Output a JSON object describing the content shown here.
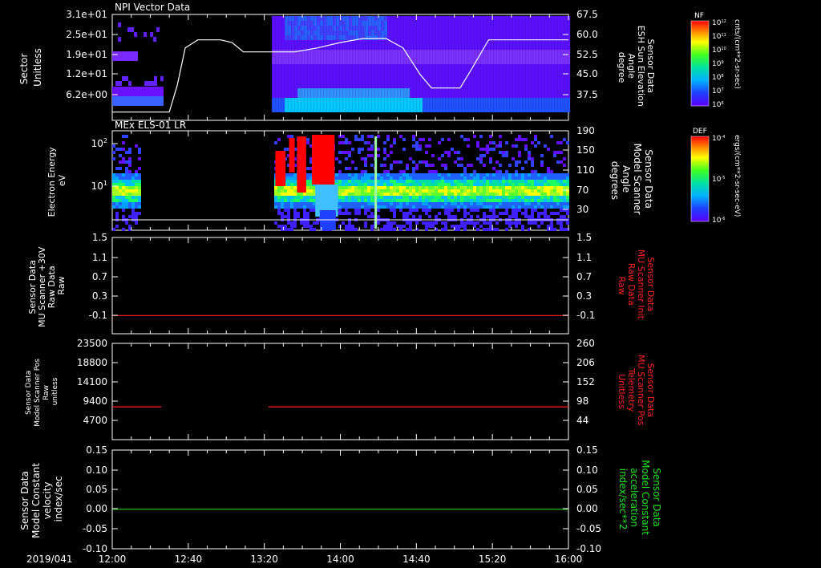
{
  "chart_data": [
    {
      "type": "heatmap",
      "title": "NPI Vector Data",
      "ylabel_left": [
        "Sector",
        "Unitless"
      ],
      "yticks_left": [
        "3.1e+01",
        "2.5e+01",
        "1.9e+01",
        "1.2e+01",
        "6.2e+00"
      ],
      "ylabel_right": [
        "Sensor Data",
        "ESH Sun Elevation",
        "Angle",
        "degree"
      ],
      "yticks_right": [
        "67.5",
        "60.0",
        "52.5",
        "45.0",
        "37.5"
      ],
      "colorbar": {
        "label": "NF",
        "units": "cnts/(cm**2-sr-sec)",
        "ticks": [
          "10^12",
          "10^11",
          "10^10",
          "10^9",
          "10^8",
          "10^7",
          "10^6"
        ]
      },
      "overlay_line": {
        "name": "ESH Sun Elevation Angle",
        "color": "#ffffff",
        "x_hours": [
          12.0,
          12.5,
          12.57,
          12.64,
          12.75,
          12.95,
          13.05,
          13.15,
          13.35,
          13.6,
          13.8,
          14.0,
          14.2,
          14.4,
          14.55,
          14.7,
          14.8,
          14.95,
          15.05,
          15.15,
          15.3,
          15.5,
          15.7,
          16.0
        ],
        "y": [
          31,
          31,
          41,
          55,
          58,
          58,
          57,
          53.5,
          53.5,
          53.5,
          55,
          57,
          58.5,
          58.5,
          55,
          45,
          40,
          40,
          40,
          47,
          58,
          58,
          58,
          58
        ]
      },
      "color": "#ffffff"
    },
    {
      "type": "heatmap",
      "title": "MEx ELS-01 LR",
      "ylabel_left": [
        "Electron Energy",
        "eV"
      ],
      "yticks_left": [
        "10^2",
        "10^1"
      ],
      "ylabel_right": [
        "Sensor Data",
        "Model Scanner",
        "Angle",
        "degrees"
      ],
      "yticks_right": [
        "190",
        "150",
        "110",
        "70",
        "30"
      ],
      "colorbar": {
        "label": "DEF",
        "units": "ergs/(cm**2-sr-sec-eV)",
        "ticks": [
          "10^-4",
          "10^-5",
          "10^-6"
        ]
      },
      "overlay_line": {
        "name": "Model Scanner Angle",
        "color": "#ffffff",
        "x_hours": [
          12.0,
          16.0
        ],
        "y": [
          10,
          10
        ]
      }
    },
    {
      "type": "line",
      "ylabel_left": [
        "Sensor Data",
        "MU Scanner +30V",
        "Raw Data",
        "Raw"
      ],
      "yticks_left": [
        "1.5",
        "1.1",
        "0.7",
        "0.3",
        "-0.1"
      ],
      "ylabel_right": [
        "Sensor Data",
        "MU Scanner Init",
        "Raw Data",
        "Raw"
      ],
      "yticks_right": [
        "1.5",
        "1.1",
        "0.7",
        "0.3",
        "-0.1"
      ],
      "ylim": [
        -0.35,
        1.5
      ],
      "series": [
        {
          "color": "#ff2020",
          "x_hours": [
            12.0,
            16.0
          ],
          "y": [
            0.0,
            0.0
          ]
        }
      ],
      "right_label_color": "#ff2020"
    },
    {
      "type": "line",
      "ylabel_left": [
        "Sensor Data",
        "Model Scanner Pos",
        "Raw",
        "unitless"
      ],
      "yticks_left": [
        "23500",
        "18800",
        "14100",
        "9400",
        "4700"
      ],
      "ylabel_right": [
        "Sensor Data",
        "MU Scanner Pos",
        "Telemetry",
        "Unitless"
      ],
      "yticks_right": [
        "260",
        "206",
        "152",
        "98",
        "44"
      ],
      "ylim": [
        0,
        23500
      ],
      "series": [
        {
          "color": "#ff2020",
          "x_hours": [
            12.0,
            12.43
          ],
          "y": [
            8000,
            8000
          ]
        },
        {
          "color": "#ff2020",
          "x_hours": [
            13.37,
            16.0
          ],
          "y": [
            8000,
            8000
          ]
        }
      ],
      "right_label_color": "#ff2020"
    },
    {
      "type": "line",
      "ylabel_left": [
        "Sensor Data",
        "Model Constant",
        "velocity",
        "index/sec"
      ],
      "yticks_left": [
        "0.15",
        "0.10",
        "0.05",
        "0.00",
        "-0.05",
        "-0.10"
      ],
      "ylabel_right": [
        "Sensor Data",
        "Model Constant",
        "acceleration",
        "index/sec**2"
      ],
      "yticks_right": [
        "0.15",
        "0.10",
        "0.05",
        "0.00",
        "-0.05",
        "-0.10"
      ],
      "ylim": [
        -0.1,
        0.15
      ],
      "series": [
        {
          "color": "#20d020",
          "x_hours": [
            12.0,
            16.0
          ],
          "y": [
            0.0,
            0.0
          ]
        }
      ],
      "right_label_color": "#20e020"
    }
  ],
  "time_axis": {
    "date": "2019/041",
    "ticks": [
      "12:00",
      "12:40",
      "13:20",
      "14:00",
      "14:40",
      "15:20",
      "16:00"
    ],
    "tick_hours": [
      12.0,
      12.667,
      13.333,
      14.0,
      14.667,
      15.333,
      16.0
    ],
    "range_hours": [
      12.0,
      16.0
    ]
  }
}
